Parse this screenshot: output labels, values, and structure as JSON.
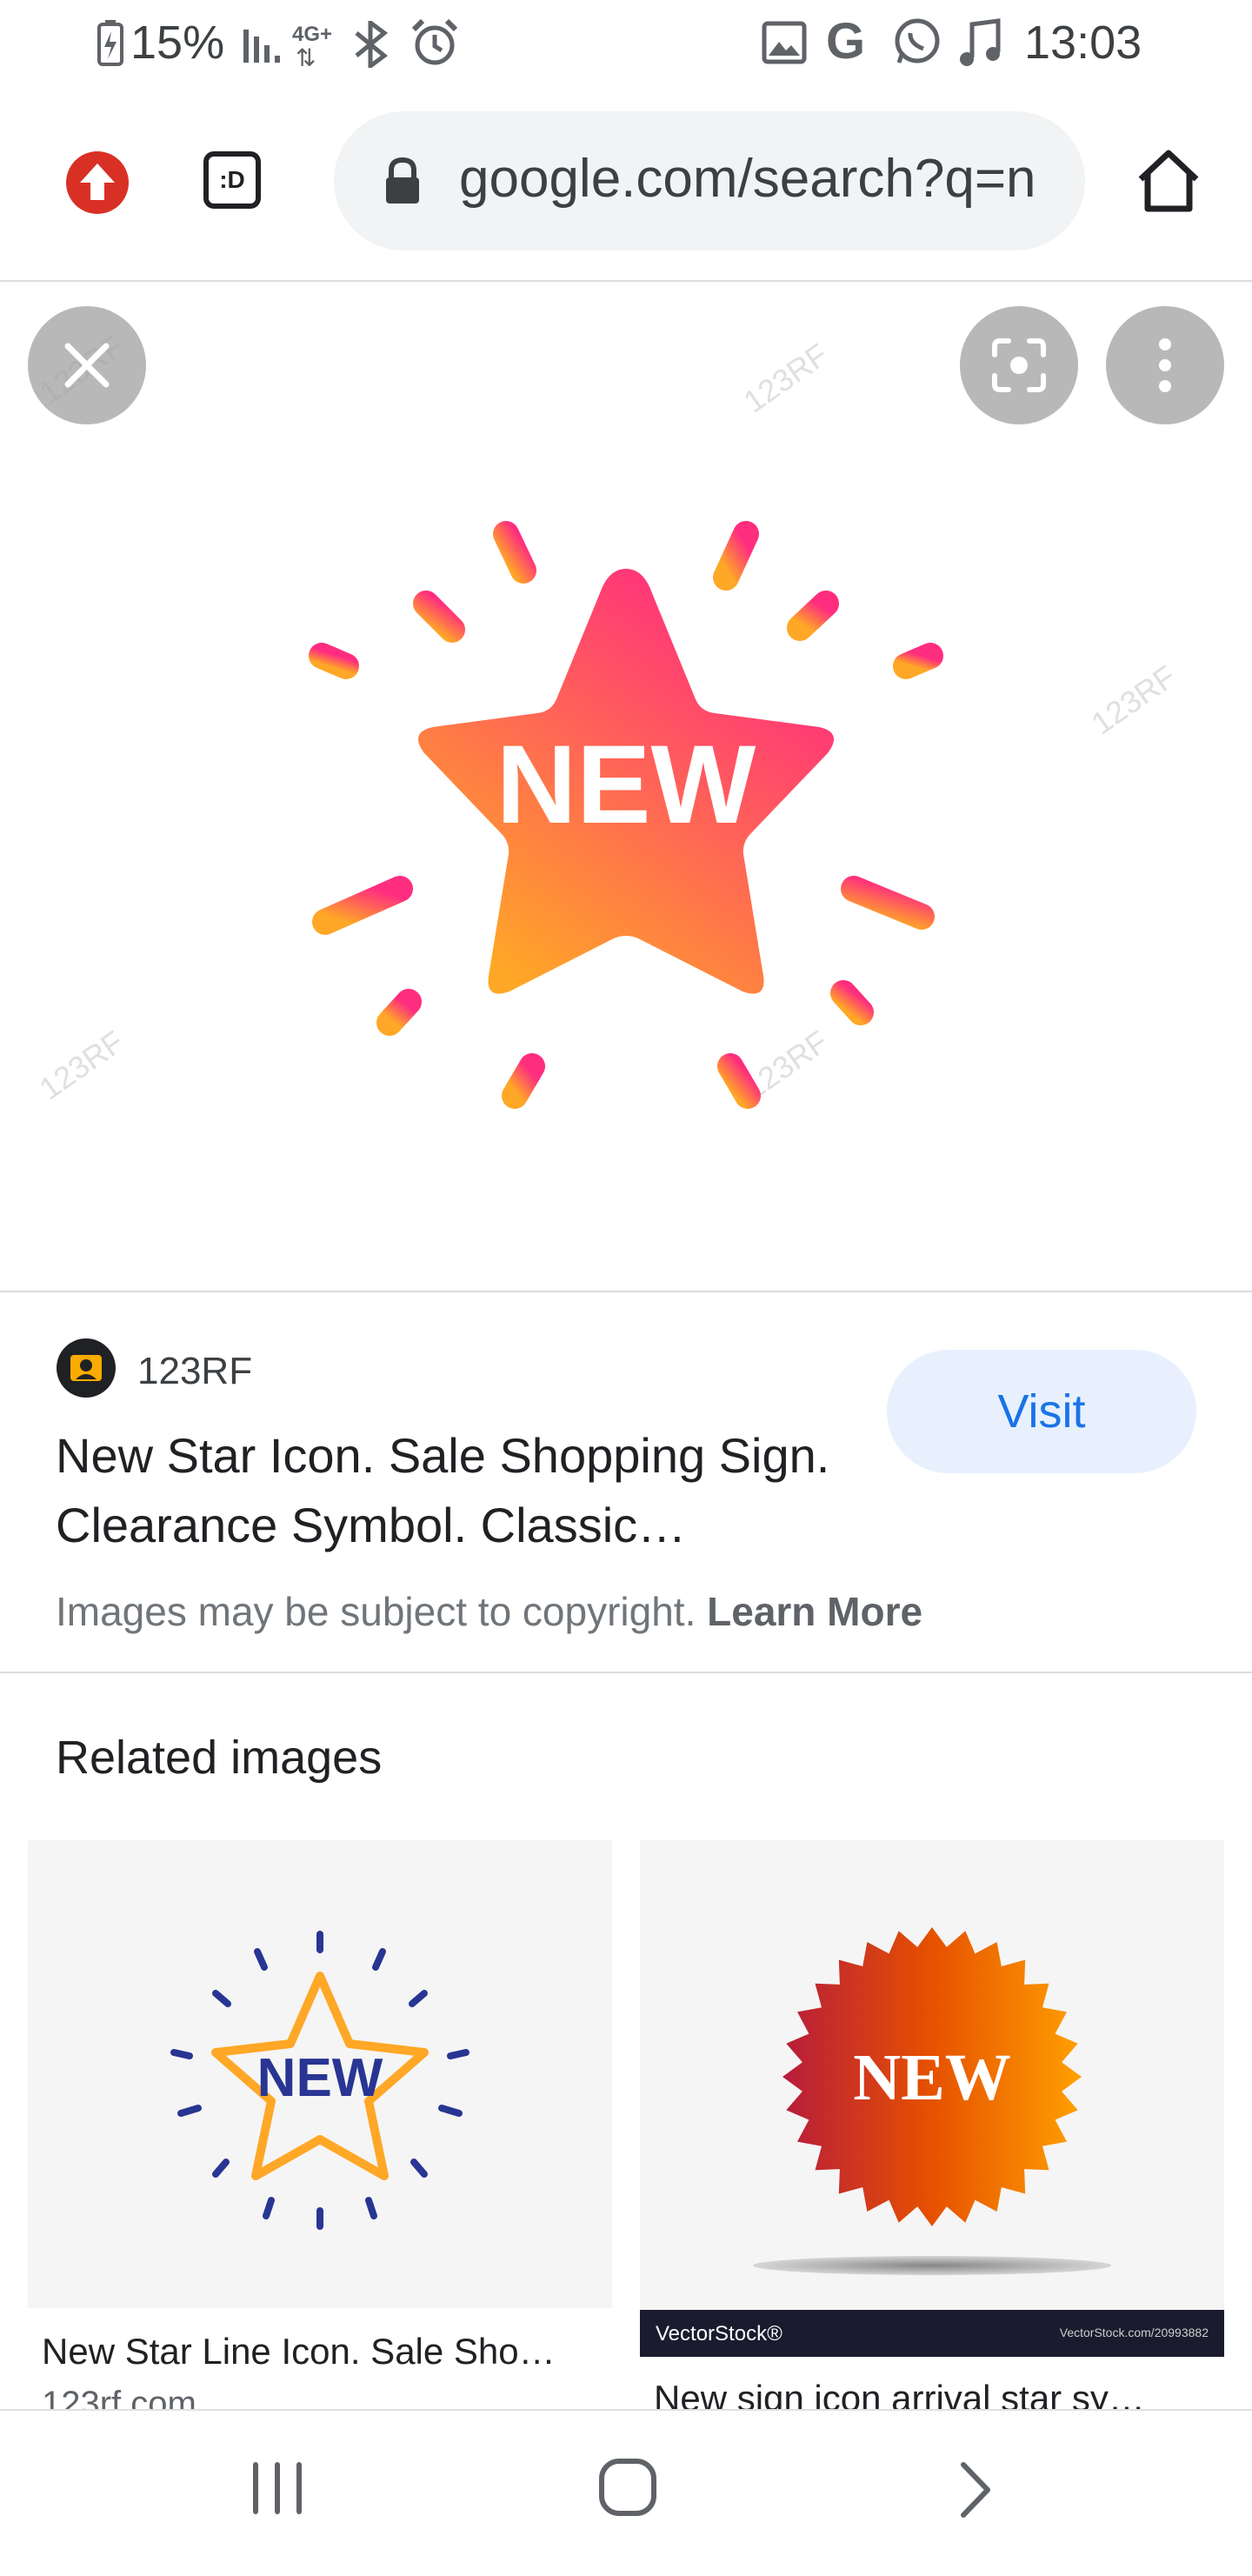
{
  "status_bar": {
    "battery": "15%",
    "network": "4G+",
    "time": "13:03"
  },
  "browser": {
    "url": "google.com/search?q=n",
    "tab_count": ":D"
  },
  "image_viewer": {
    "main_image_text": "NEW",
    "watermark": "123RF"
  },
  "result": {
    "source_name": "123RF",
    "title": "New Star Icon. Sale Shopping Sign. Clearance Symbol. Classic…",
    "visit_label": "Visit",
    "copyright_text": "Images may be subject to copyright.",
    "learn_more": "Learn More"
  },
  "related": {
    "heading": "Related images",
    "items": [
      {
        "image_text": "NEW",
        "title": "New Star Line Icon. Sale Sho…",
        "source": "123rf.com"
      },
      {
        "image_text": "NEW",
        "title": "New sign icon arrival star sy…",
        "banner_left": "VectorStock®",
        "banner_right": "VectorStock.com/20993882"
      }
    ]
  },
  "colors": {
    "accent": "#1a73e8",
    "visit_bg": "#e8f0fe",
    "star_top": "#ff3d7f",
    "star_bottom": "#ffa726"
  }
}
